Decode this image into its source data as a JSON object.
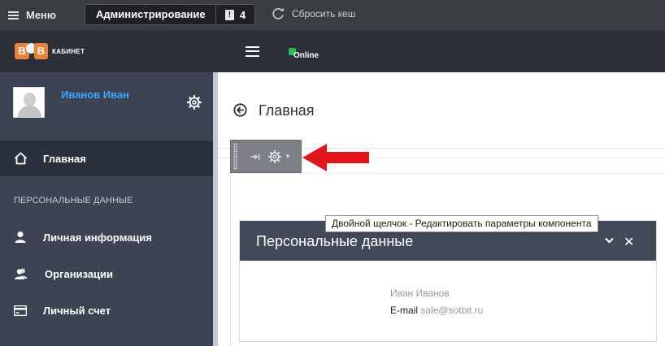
{
  "adminbar": {
    "menu_label": "Меню",
    "admin_label": "Администрирование",
    "notifications_count": "4",
    "cache_label": "Сбросить кеш"
  },
  "header": {
    "logo_letters": [
      "В",
      "В"
    ],
    "logo_caption": "КАБИНЕТ",
    "status_label": "Online",
    "status_color": "#2dbb4a"
  },
  "sidebar": {
    "user_name": "Иванов Иван",
    "home_label": "Главная",
    "section_title": "ПЕРСОНАЛЬНЫЕ ДАННЫЕ",
    "items": [
      {
        "label": "Личная информация",
        "icon": "user-icon"
      },
      {
        "label": "Организации",
        "icon": "users-icon"
      },
      {
        "label": "Личный счет",
        "icon": "card-icon"
      }
    ]
  },
  "main": {
    "page_title": "Главная",
    "tooltip": "Двойной щелчок - Редактировать параметры компонента",
    "card": {
      "title": "Персональные данные",
      "person_name": "Иван Иванов",
      "email_label": "E-mail",
      "email_value": "sale@sotbit.ru"
    }
  },
  "colors": {
    "accent_link": "#38a7ff",
    "sidebar_bg": "#3c4453",
    "header_bg": "#2b2f3a",
    "card_head_bg": "#424a59",
    "arrow": "#e0161c",
    "logo_orange": "#e8833a"
  }
}
